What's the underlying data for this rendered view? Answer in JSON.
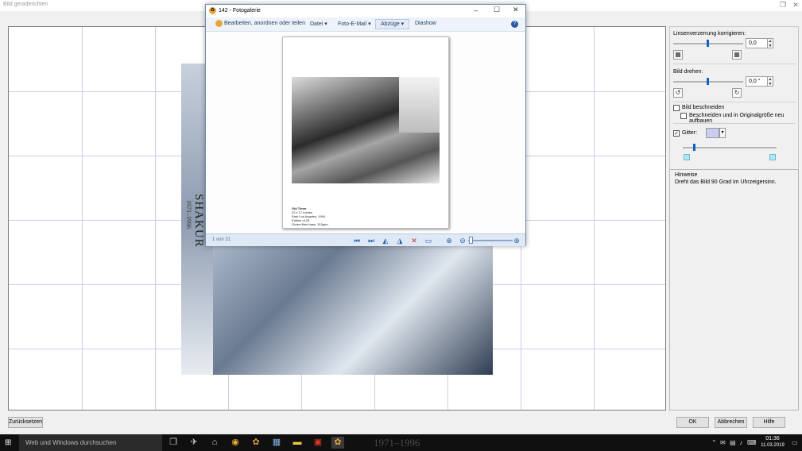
{
  "window": {
    "title": "Bild geraderichten",
    "restore_icon": "restore-icon",
    "close_icon": "close-icon"
  },
  "photo": {
    "vertical_text_large": "SHAKUR",
    "vertical_text_small": "1971–1996"
  },
  "panel": {
    "lens_label": "Linsenverzerrung korrigieren:",
    "lens_value": "0,0",
    "rotate_label": "Bild drehen:",
    "rotate_value": "0,0 °",
    "crop_label": "Bild beschneiden",
    "crop_rebuild_label": "Beschneiden und in Originalgröße neu aufbauen",
    "grid_label": "Gitter:",
    "grid_color": "#c9cdf0",
    "accent_color": "#0a64c8",
    "grid_checked": true,
    "crop_checked": false,
    "crop_rebuild_checked": false,
    "lens_slider_fraction": 0.5,
    "rotate_slider_fraction": 0.5,
    "grid_slider_fraction": 0.12
  },
  "hint": {
    "title": "Hinweise",
    "text": "Dreht das Bild 90 Grad im Uhrzeigersinn."
  },
  "buttons": {
    "reset": "Zurücksetzen",
    "ok": "OK",
    "cancel": "Abbrechen",
    "help": "Hilfe"
  },
  "gallery": {
    "title": "142 - Fotogalerie",
    "menu": [
      "Bearbeiten, anordnen oder teilen",
      "Datei ▾",
      "Foto-E-Mail ▾",
      "Abzüge ▾",
      "Diashow"
    ],
    "page_counter": "1 von 31",
    "caption_lines": [
      "Old Timer",
      "22 x 17 Inches",
      "East Los Angeles, 1994",
      "Edition of 25",
      "Giclee fiber base, 310g/m"
    ]
  },
  "taskbar": {
    "search_placeholder": "Web und Windows durchsuchen",
    "time": "01:36",
    "date": "11.03.2019",
    "background_text": "1971–1996"
  }
}
